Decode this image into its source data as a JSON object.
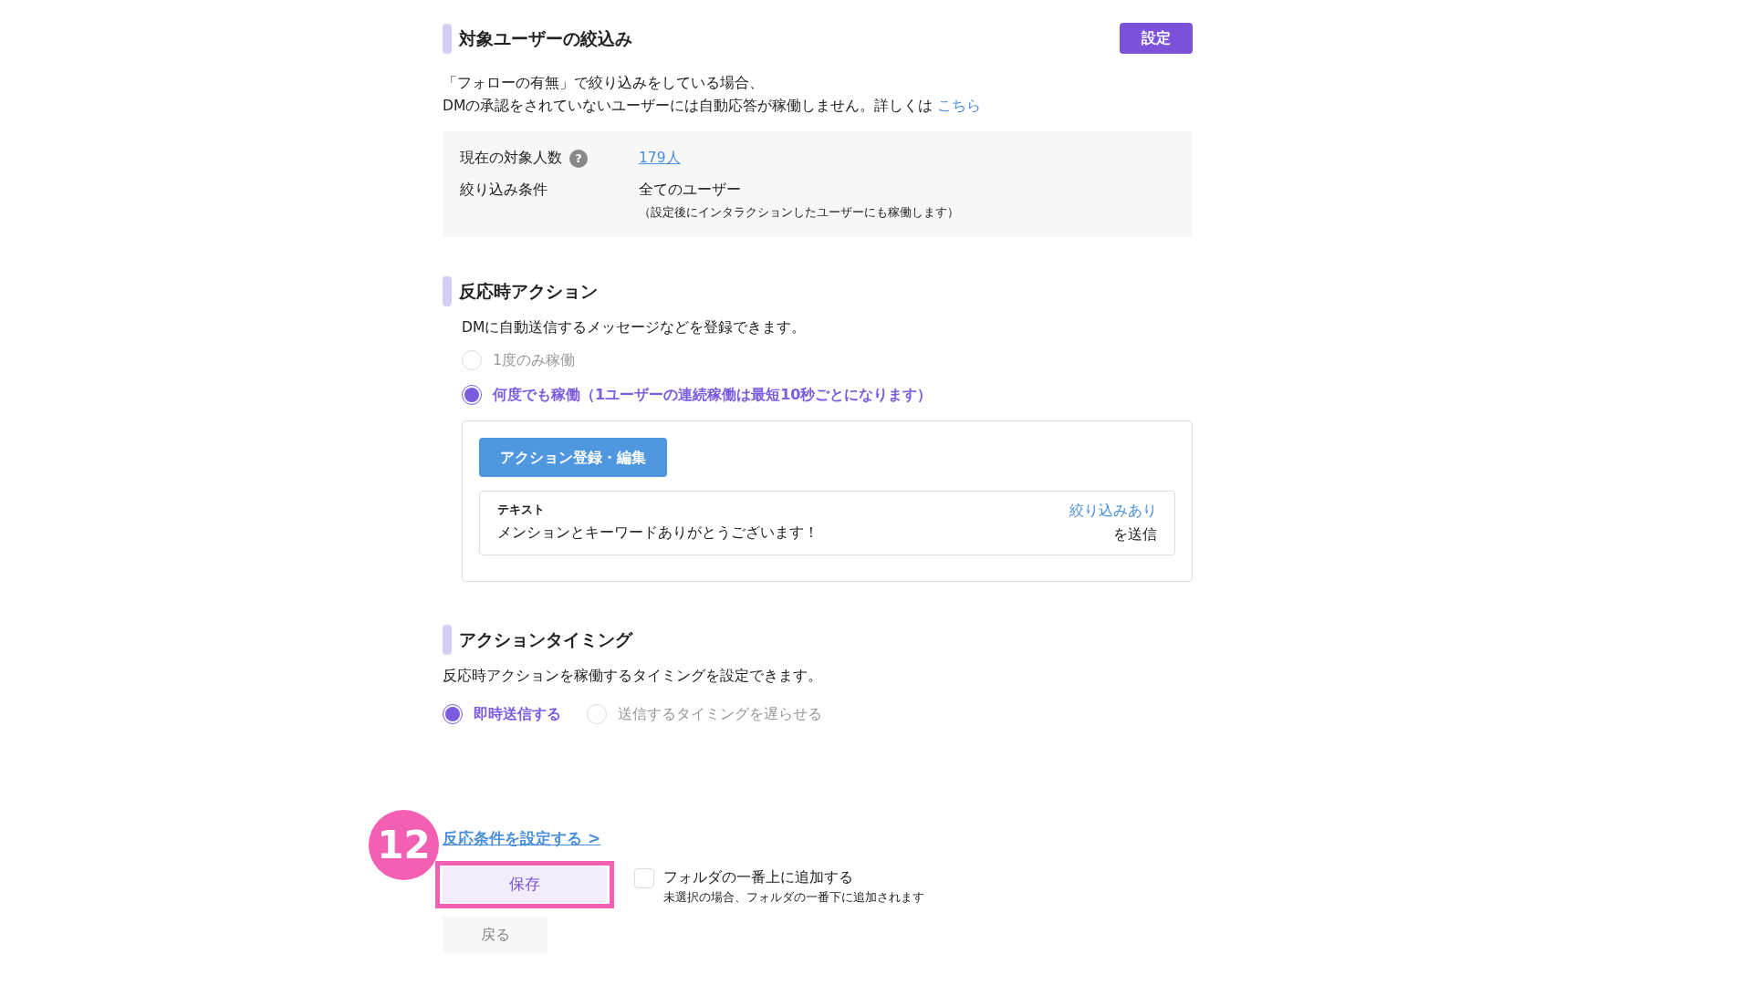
{
  "filter_section": {
    "title": "対象ユーザーの絞込み",
    "button": "設定",
    "notes": [
      "「フォローの有無」で絞り込みをしている場合、"
    ],
    "note_with_link": {
      "text": "DMの承認をされていないユーザーには自動応答が稼働しません。詳しくは",
      "link": "こちら"
    },
    "info_rows": [
      {
        "label": "現在の対象人数",
        "help": "?",
        "kind": "link",
        "value": "179人"
      },
      {
        "label": "絞り込み条件",
        "kind": "text",
        "value": "全てのユーザー",
        "sub": "（設定後にインタラクションしたユーザーにも稼働します）"
      }
    ]
  },
  "action_section": {
    "title": "反応時アクション",
    "description": "DMに自動送信するメッセージなどを登録できます。",
    "options": [
      {
        "label": "1度のみ稼働",
        "selected": false
      },
      {
        "label": "何度でも稼働（1ユーザーの連続稼働は最短10秒ごとになります）",
        "selected": true
      }
    ],
    "edit_button": "アクション登録・編集",
    "action_card": {
      "type": "テキスト",
      "message": "メンションとキーワードありがとうございます！",
      "filter_link": "絞り込みあり",
      "suffix": "を送信"
    }
  },
  "timing_section": {
    "title": "アクションタイミング",
    "description": "反応時アクションを稼働するタイミングを設定できます。",
    "options": [
      {
        "label": "即時送信する",
        "selected": true
      },
      {
        "label": "送信するタイミングを遅らせる",
        "selected": false
      }
    ]
  },
  "condition_link": "反応条件を設定する >",
  "step_badge": "12",
  "save_button": "保存",
  "top_of_folder": {
    "label": "フォルダの一番上に追加する",
    "hint": "未選択の場合、フォルダの一番下に追加されます",
    "checked": false
  },
  "back_button": "戻る"
}
